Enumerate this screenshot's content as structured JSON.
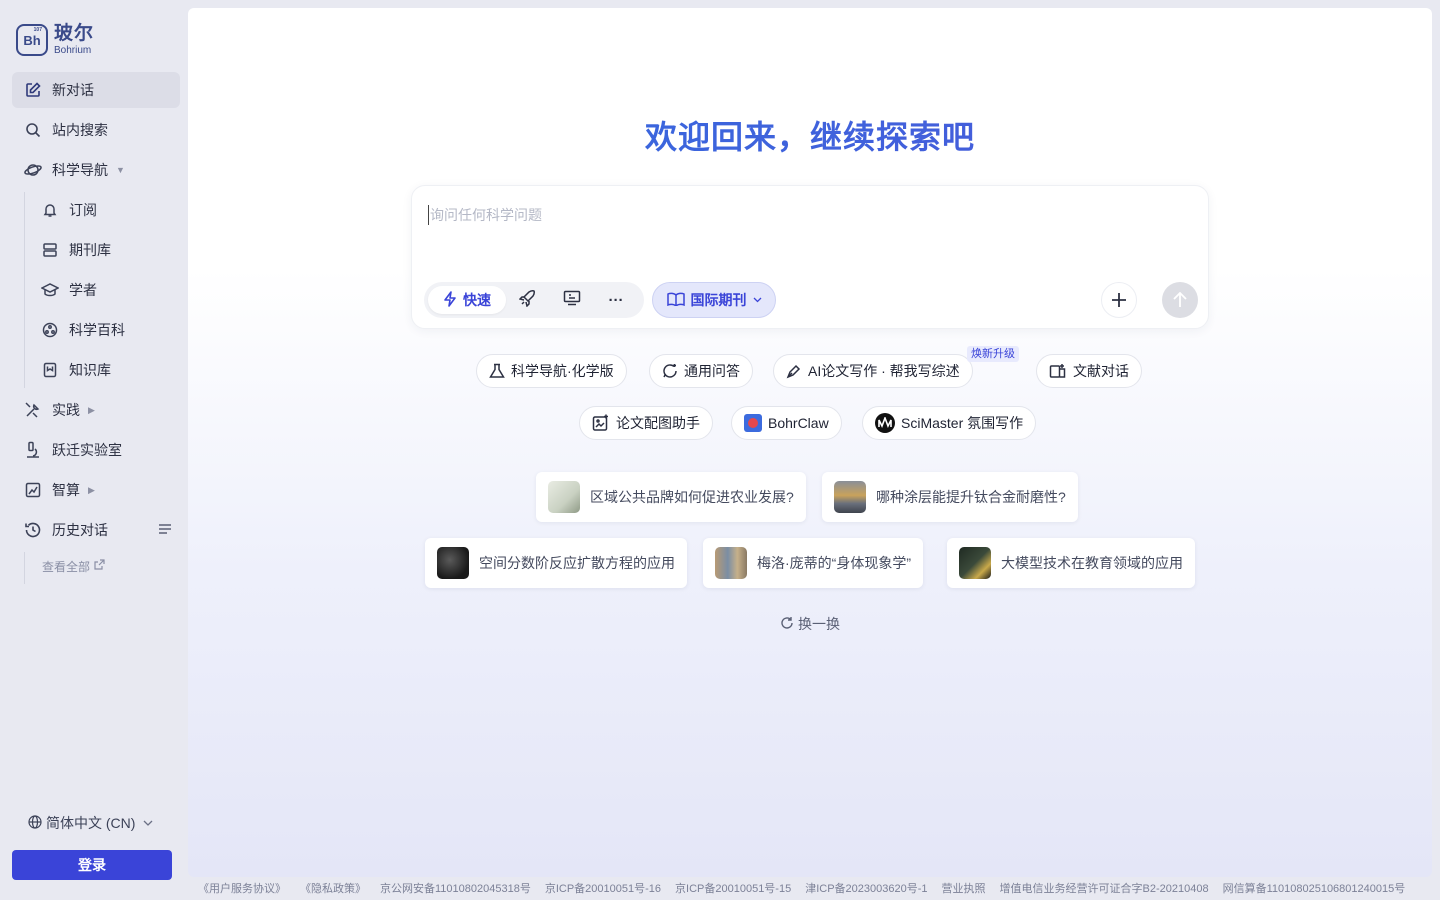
{
  "logo": {
    "cn": "玻尔",
    "en": "Bohrium",
    "mark": "Bh",
    "mark_num": "107"
  },
  "nav": {
    "new_chat": "新对话",
    "search": "站内搜索",
    "sci_nav": "科学导航",
    "sci_sub": [
      "订阅",
      "期刊库",
      "学者",
      "科学百科",
      "知识库"
    ],
    "practice": "实践",
    "lab": "跃迁实验室",
    "compute": "智算",
    "history": "历史对话",
    "view_all": "查看全部"
  },
  "lang": "简体中文 (CN)",
  "login": "登录",
  "main": {
    "welcome": "欢迎回来，继续探索吧",
    "placeholder": "询问任何科学问题",
    "mode_fast": "快速",
    "journal": "国际期刊",
    "chips_row1": [
      "科学导航·化学版",
      "通用问答",
      "AI论文写作 · 帮我写综述",
      "文献对话"
    ],
    "upgrade_tag": "焕新升级",
    "chips_row2": [
      "论文配图助手",
      "BohrClaw",
      "SciMaster 氛围写作"
    ],
    "suggestions_row1": [
      "区域公共品牌如何促进农业发展?",
      "哪种涂层能提升钛合金耐磨性?"
    ],
    "suggestions_row2": [
      "空间分数阶反应扩散方程的应用",
      "梅洛·庞蒂的“身体现象学”",
      "大模型技术在教育领域的应用"
    ],
    "refresh": "换一换"
  },
  "footer": [
    "《用户服务协议》",
    "《隐私政策》",
    "京公网安备11010802045318号",
    "京ICP备20010051号-16",
    "京ICP备20010051号-15",
    "津ICP备2023003620号-1",
    "营业执照",
    "增值电信业务经营许可证合字B2-20210408",
    "网信算备110108025106801240015号"
  ],
  "colors": {
    "accent": "#3a44d8",
    "welcome_start": "#2f6fe0",
    "welcome_end": "#4f55d8"
  }
}
